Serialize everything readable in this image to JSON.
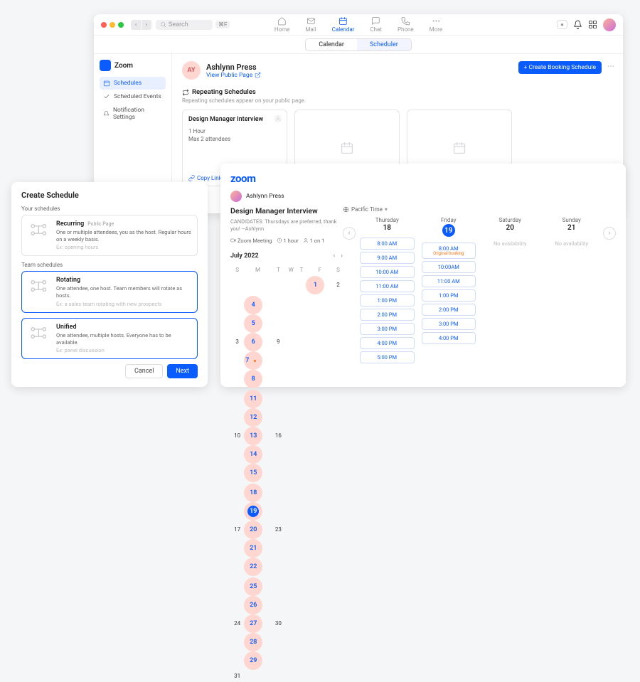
{
  "topbar": {
    "search_placeholder": "Search",
    "kbd": "⌘F",
    "nav": [
      "Home",
      "Mail",
      "Calendar",
      "Chat",
      "Phone",
      "More"
    ],
    "active_nav_index": 2
  },
  "subtabs": {
    "items": [
      "Calendar",
      "Scheduler"
    ],
    "active_index": 1
  },
  "sidebar": {
    "brand": "Zoom",
    "items": [
      "Schedules",
      "Scheduled Events",
      "Notification Settings"
    ],
    "active_index": 0
  },
  "profile": {
    "initials": "AY",
    "name": "Ashlynn Press",
    "public_link": "View Public Page",
    "create_btn": "+ Create Booking Schedule"
  },
  "section": {
    "title": "Repeating Schedules",
    "subtitle": "Repeating schedules appear on your public page."
  },
  "schedule_card": {
    "title": "Design Manager Interview",
    "duration": "1 Hour",
    "attendees": "Max 2 attendees",
    "copy": "Copy Link"
  },
  "modal": {
    "title": "Create Schedule",
    "your_label": "Your schedules",
    "team_label": "Team schedules",
    "options": [
      {
        "title": "Recurring",
        "tag": "Public Page",
        "desc": "One or multiple attendees, you as the host. Regular hours on a weekly basis.",
        "ex": "Ex: opening hours"
      },
      {
        "title": "Rotating",
        "desc": "One attendee, one host. Team members will rotate as hosts.",
        "ex": "Ex: a sales team rotating with new prospects"
      },
      {
        "title": "Unified",
        "desc": "One attendee, multiple hosts. Everyone has to be available.",
        "ex": "Ex: panel discussion"
      }
    ],
    "cancel": "Cancel",
    "next": "Next"
  },
  "booking": {
    "logo": "zoom",
    "host": "Ashlynn Press",
    "title": "Design Manager Interview",
    "note": "CANDIDATES: Thursdays are preferred, thank you! –Ashlynn",
    "meta": {
      "type": "Zoom Meeting",
      "duration": "1 hour",
      "capacity": "1 on 1"
    },
    "timezone": "Pacific Time",
    "month": "July 2022",
    "dow": [
      "S",
      "M",
      "T",
      "W",
      "T",
      "F",
      "S"
    ],
    "weeks": [
      [
        {
          "d": ""
        },
        {
          "d": ""
        },
        {
          "d": ""
        },
        {
          "d": ""
        },
        {
          "d": ""
        },
        {
          "d": "1",
          "av": 1
        },
        {
          "d": "2"
        }
      ],
      [
        {
          "d": "3"
        },
        {
          "d": "4",
          "av": 1
        },
        {
          "d": "5",
          "av": 1
        },
        {
          "d": "6",
          "av": 1
        },
        {
          "d": "7",
          "av": 1,
          "dot": 1
        },
        {
          "d": "8",
          "av": 1
        },
        {
          "d": "9"
        }
      ],
      [
        {
          "d": "10"
        },
        {
          "d": "11",
          "av": 1
        },
        {
          "d": "12",
          "av": 1
        },
        {
          "d": "13",
          "av": 1
        },
        {
          "d": "14",
          "av": 1
        },
        {
          "d": "15",
          "av": 1
        },
        {
          "d": "16"
        }
      ],
      [
        {
          "d": "17"
        },
        {
          "d": "18",
          "av": 1
        },
        {
          "d": "19",
          "av": 1
        },
        {
          "d": "20",
          "av": 1
        },
        {
          "d": "21",
          "av": 1
        },
        {
          "d": "22",
          "av": 1
        },
        {
          "d": "23"
        }
      ],
      [
        {
          "d": "24"
        },
        {
          "d": "25",
          "av": 1
        },
        {
          "d": "26",
          "av": 1
        },
        {
          "d": "27",
          "av": 1
        },
        {
          "d": "28",
          "av": 1
        },
        {
          "d": "29",
          "av": 1
        },
        {
          "d": "30"
        }
      ],
      [
        {
          "d": "31"
        },
        {
          "d": ""
        },
        {
          "d": ""
        },
        {
          "d": ""
        },
        {
          "d": ""
        },
        {
          "d": ""
        },
        {
          "d": ""
        }
      ]
    ],
    "selected_cal_day": "19",
    "days": [
      {
        "name": "Thursday",
        "date": "18",
        "slots": [
          "8:00 AM",
          "9:00 AM",
          "10:00 AM",
          "11:00 AM",
          "1:00 PM",
          "2:00 PM",
          "3:00 PM",
          "4:00 PM",
          "5:00 PM"
        ]
      },
      {
        "name": "Friday",
        "date": "19",
        "selected": true,
        "slots": [
          {
            "t": "8:00 AM",
            "orig": "Original booking"
          },
          "10:00AM",
          "11:00 AM",
          "1:00 PM",
          "2:00 PM",
          "3:00 PM",
          "4:00 PM"
        ]
      },
      {
        "name": "Saturday",
        "date": "20",
        "noav": "No availability"
      },
      {
        "name": "Sunday",
        "date": "21",
        "noav": "No availability"
      }
    ]
  }
}
